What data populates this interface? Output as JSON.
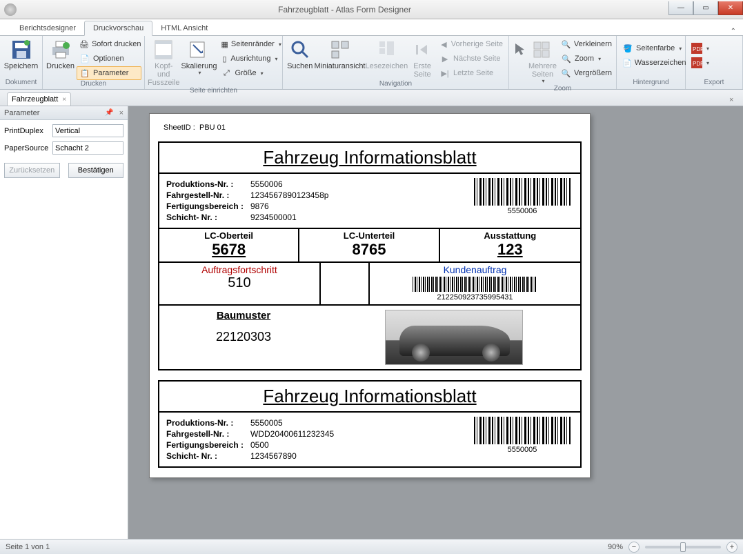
{
  "window": {
    "title": "Fahrzeugblatt - Atlas Form Designer"
  },
  "ribbonTabs": {
    "reportDesigner": "Berichtsdesigner",
    "printPreview": "Druckvorschau",
    "htmlView": "HTML Ansicht"
  },
  "ribbon": {
    "groups": {
      "dokument": {
        "label": "Dokument",
        "save": "Speichern"
      },
      "drucken": {
        "label": "Drucken",
        "print": "Drucken",
        "sofort": "Sofort drucken",
        "optionen": "Optionen",
        "parameter": "Parameter"
      },
      "seiteEinrichten": {
        "label": "Seite einrichten",
        "kopfFuss1": "Kopf- und",
        "kopfFuss2": "Fusszeile",
        "skalierung": "Skalierung",
        "seitenraender": "Seitenränder",
        "ausrichtung": "Ausrichtung",
        "groesse": "Größe"
      },
      "navigation": {
        "label": "Navigation",
        "suchen": "Suchen",
        "miniatur": "Miniaturansicht",
        "lesezeichen": "Lesezeichen",
        "ersteSeite": "Erste\nSeite",
        "vorherige": "Vorherige Seite",
        "naechste": "Nächste Seite",
        "letzte": "Letzte Seite"
      },
      "zoom": {
        "label": "Zoom",
        "mehrere": "Mehrere\nSeiten",
        "verkleinern": "Verkleinern",
        "zoom": "Zoom",
        "vergroessern": "Vergrößern"
      },
      "hintergrund": {
        "label": "Hintergrund",
        "seitenfarbe": "Seitenfarbe",
        "wasserzeichen": "Wasserzeichen"
      },
      "export": {
        "label": "Export"
      }
    }
  },
  "docTab": {
    "name": "Fahrzeugblatt"
  },
  "paramPanel": {
    "title": "Parameter",
    "printDuplexLabel": "PrintDuplex",
    "printDuplexValue": "Vertical",
    "paperSourceLabel": "PaperSource",
    "paperSourceValue": "Schacht 2",
    "reset": "Zurücksetzen",
    "submit": "Bestätigen"
  },
  "preview": {
    "sheetIdLabel": "SheetID :",
    "sheetIdValue": "PBU 01",
    "formTitle": "Fahrzeug Informationsblatt",
    "labels": {
      "prodNr": "Produktions-Nr. :",
      "fahrgestell": "Fahrgestell-Nr. :",
      "fertigungsbereich": "Fertigungsbereich :",
      "schicht": "Schicht- Nr. :",
      "lcOber": "LC-Oberteil",
      "lcUnter": "LC-Unterteil",
      "ausstattung": "Ausstattung",
      "auftrag": "Auftragsfortschritt",
      "kunden": "Kundenauftrag",
      "baumuster": "Baumuster"
    },
    "record1": {
      "prodNr": "5550006",
      "fahrgestell": "1234567890123458p",
      "fertigungsbereich": "9876",
      "schicht": "9234500001",
      "barcodeCaption": "5550006",
      "lcOber": "5678",
      "lcUnter": "8765",
      "ausstattung": "123",
      "auftragVal": "510",
      "kundenVal": "212250923735995431",
      "baumusterVal": "22120303"
    },
    "record2": {
      "prodNr": "5550005",
      "fahrgestell": "WDD20400611232345",
      "fertigungsbereich": "0500",
      "schicht": "1234567890",
      "barcodeCaption": "5550005"
    }
  },
  "statusbar": {
    "pageInfo": "Seite 1 von 1",
    "zoom": "90%"
  }
}
